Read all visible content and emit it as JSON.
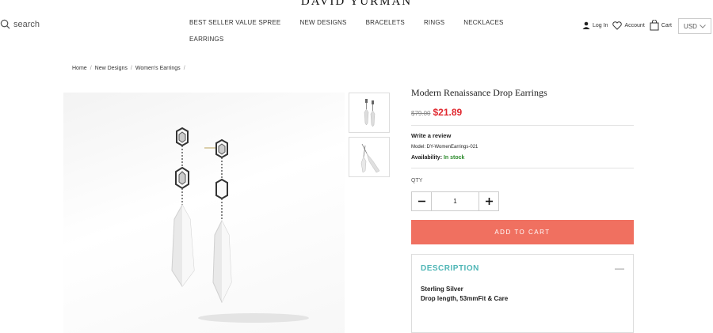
{
  "header": {
    "brand": "DAVID YURMAN",
    "search_label": "search",
    "nav": [
      "BEST SELLER VALUE SPREE",
      "NEW DESIGNS",
      "BRACELETS",
      "RINGS",
      "NECKLACES",
      "EARRINGS"
    ],
    "login": "Log In",
    "account": "Account",
    "cart": "Cart",
    "currency": "USD"
  },
  "breadcrumb": [
    "Home",
    "New Designs",
    "Women's Earrings"
  ],
  "product": {
    "title": "Modern Renaissance Drop Earrings",
    "old_price": "$79.00",
    "new_price": "$21.89",
    "review": "Write a review",
    "model": "Model: DY-WomenEarrings-021",
    "availability_label": "Availability:",
    "availability_value": "In stock",
    "qty_label": "QTY",
    "qty": "1",
    "add_to_cart": "ADD TO CART",
    "description_title": "DESCRIPTION",
    "description_toggle": "—",
    "description_line1": "Sterling Silver",
    "description_line2": "Drop length, 53mmFit & Care"
  },
  "colors": {
    "accent": "#f07060",
    "price": "#e0282f",
    "stock": "#2b8a2b",
    "desc_title": "#4fb6b6"
  }
}
